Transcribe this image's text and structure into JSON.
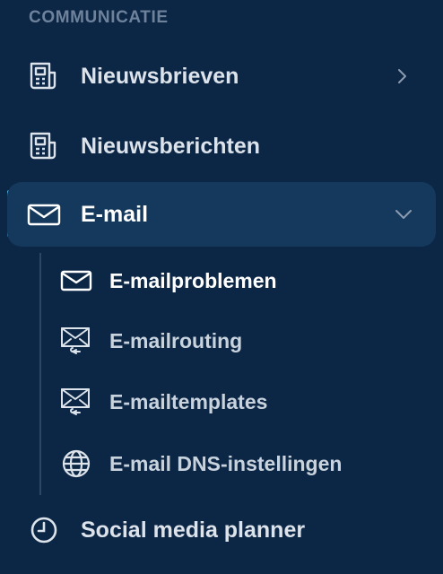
{
  "sidebar": {
    "section_title": "COMMUNICATIE",
    "items": [
      {
        "label": "Nieuwsbrieven",
        "icon": "newspaper-icon",
        "has_chevron": "chevron-right-icon"
      },
      {
        "label": "Nieuwsberichten",
        "icon": "newspaper-icon"
      },
      {
        "label": "E-mail",
        "icon": "envelope-icon",
        "active": true,
        "has_chevron": "chevron-down-icon"
      },
      {
        "label": "Social media planner",
        "icon": "clock-icon"
      }
    ],
    "email_submenu": [
      {
        "label": "E-mailproblemen",
        "icon": "envelope-icon",
        "current": true
      },
      {
        "label": "E-mailrouting",
        "icon": "envelope-forward-icon"
      },
      {
        "label": "E-mailtemplates",
        "icon": "envelope-forward-icon"
      },
      {
        "label": "E-mail DNS-instellingen",
        "icon": "globe-icon"
      }
    ]
  },
  "colors": {
    "background": "#0c2645",
    "active_background": "#15395d",
    "active_indicator": "#4fb5e8",
    "section_title": "#6e829b",
    "text": "#dce3eb"
  }
}
